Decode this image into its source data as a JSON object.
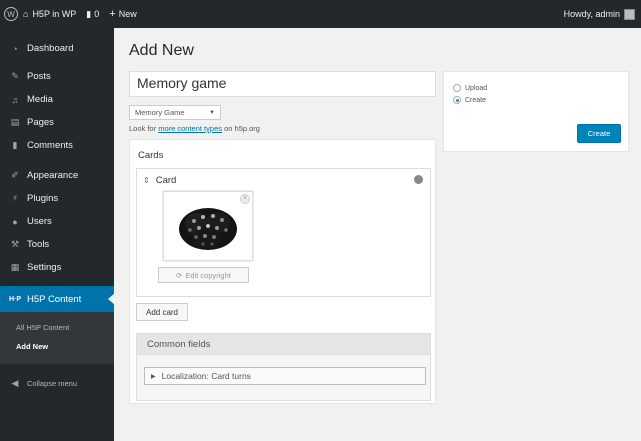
{
  "adminbar": {
    "site_name": "H5P in WP",
    "comments_count": "0",
    "new_label": "New",
    "greeting": "Howdy, admin"
  },
  "sidebar": {
    "items": [
      {
        "label": "Dashboard",
        "icon": "dashboard-icon"
      },
      {
        "label": "Posts",
        "icon": "pin-icon"
      },
      {
        "label": "Media",
        "icon": "media-icon"
      },
      {
        "label": "Pages",
        "icon": "pages-icon"
      },
      {
        "label": "Comments",
        "icon": "comment-icon"
      },
      {
        "label": "Appearance",
        "icon": "brush-icon"
      },
      {
        "label": "Plugins",
        "icon": "plug-icon"
      },
      {
        "label": "Users",
        "icon": "users-icon"
      },
      {
        "label": "Tools",
        "icon": "wrench-icon"
      },
      {
        "label": "Settings",
        "icon": "settings-icon"
      }
    ],
    "active": {
      "label": "H5P Content",
      "icon": "h5p-icon"
    },
    "submenu": [
      "All H5P Content",
      "Add New"
    ],
    "collapse_label": "Collapse menu"
  },
  "main": {
    "page_title": "Add New",
    "title_value": "Memory game",
    "content_type": "Memory Game",
    "note_prefix": "Look for",
    "note_link": "more content types",
    "note_suffix": "on h5p.org"
  },
  "editor": {
    "cards_label": "Cards",
    "card_label": "Card",
    "copyright_label": "Edit copyright",
    "add_card_label": "Add card",
    "common_fields_label": "Common fields",
    "localization_label": "Localization: Card turns"
  },
  "side": {
    "options": [
      {
        "label": "Upload",
        "checked": false
      },
      {
        "label": "Create",
        "checked": true
      }
    ],
    "create_label": "Create"
  },
  "colors": {
    "accent": "#0073aa",
    "sidebar_bg": "#23282d",
    "background": "#f1f1f1"
  }
}
